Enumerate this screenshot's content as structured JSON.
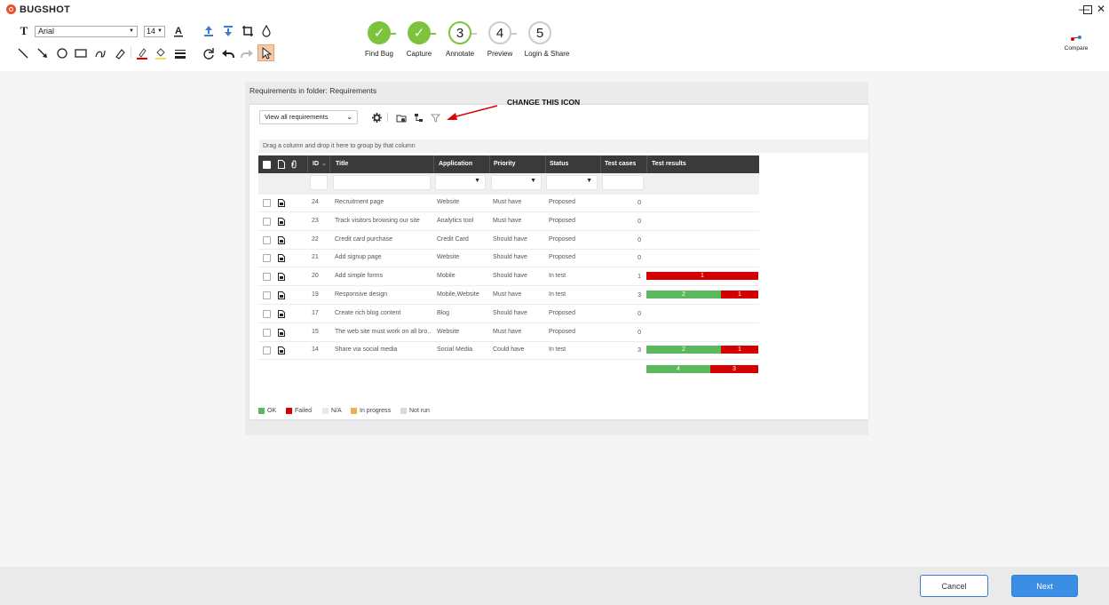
{
  "app": {
    "title": "BUGSHOT",
    "minimize": "—",
    "maximize": "□",
    "close": "✕"
  },
  "toolbar": {
    "font_family": "Arial",
    "font_size": "14",
    "compare_label": "Compare"
  },
  "steps": [
    {
      "label": "Find Bug",
      "number": "✓",
      "state": "done"
    },
    {
      "label": "Capture",
      "number": "✓",
      "state": "done"
    },
    {
      "label": "Annotate",
      "number": "3",
      "state": "current"
    },
    {
      "label": "Preview",
      "number": "4",
      "state": "todo"
    },
    {
      "label": "Login & Share",
      "number": "5",
      "state": "todo"
    }
  ],
  "screenshot": {
    "title": "Requirements in folder: Requirements",
    "view_select": "View all requirements",
    "drag_hint": "Drag a column and drop it here to group by that column",
    "annotation_text": "CHANGE THIS ICON",
    "annotation_color": "#e00000",
    "columns": {
      "id": "ID",
      "title": "Title",
      "application": "Application",
      "priority": "Priority",
      "status": "Status",
      "test_cases": "Test cases",
      "test_results": "Test results"
    },
    "rows": [
      {
        "id": "24",
        "title": "Recruitment page",
        "application": "Website",
        "priority": "Must have",
        "status": "Proposed",
        "test_cases": "0",
        "ok": 0,
        "failed": 0
      },
      {
        "id": "23",
        "title": "Track visitors browsing our site",
        "application": "Analytics tool",
        "priority": "Must have",
        "status": "Proposed",
        "test_cases": "0",
        "ok": 0,
        "failed": 0
      },
      {
        "id": "22",
        "title": "Credit card purchase",
        "application": "Credit Card",
        "priority": "Should have",
        "status": "Proposed",
        "test_cases": "0",
        "ok": 0,
        "failed": 0
      },
      {
        "id": "21",
        "title": "Add signup page",
        "application": "Website",
        "priority": "Should have",
        "status": "Proposed",
        "test_cases": "0",
        "ok": 0,
        "failed": 0
      },
      {
        "id": "20",
        "title": "Add simple forms",
        "application": "Mobile",
        "priority": "Should have",
        "status": "In test",
        "test_cases": "1",
        "ok": 0,
        "failed": 1
      },
      {
        "id": "19",
        "title": "Responsive design",
        "application": "Mobile,Website",
        "priority": "Must have",
        "status": "In test",
        "test_cases": "3",
        "ok": 2,
        "failed": 1
      },
      {
        "id": "17",
        "title": "Create rich blog content",
        "application": "Blog",
        "priority": "Should have",
        "status": "Proposed",
        "test_cases": "0",
        "ok": 0,
        "failed": 0
      },
      {
        "id": "15",
        "title": "The web site must work on all bro...",
        "application": "Website",
        "priority": "Must have",
        "status": "Proposed",
        "test_cases": "0",
        "ok": 0,
        "failed": 0
      },
      {
        "id": "14",
        "title": "Share via social media",
        "application": "Social Media",
        "priority": "Could have",
        "status": "In test",
        "test_cases": "3",
        "ok": 2,
        "failed": 1
      }
    ],
    "totals": {
      "ok": 4,
      "failed": 3
    },
    "legend": [
      {
        "label": "OK",
        "color": "#5cb85c"
      },
      {
        "label": "Failed",
        "color": "#d40000"
      },
      {
        "label": "N/A",
        "color": "#e8e8e8"
      },
      {
        "label": "In progress",
        "color": "#f0ad4e"
      },
      {
        "label": "Not run",
        "color": "#d9d9d9"
      }
    ]
  },
  "footer": {
    "cancel_label": "Cancel",
    "next_label": "Next"
  }
}
